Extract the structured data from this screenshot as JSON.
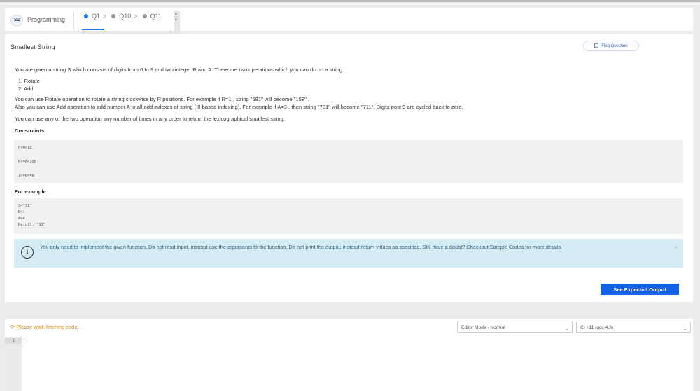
{
  "nav": {
    "section_badge": "S2",
    "section_name": "Programming",
    "questions": [
      {
        "label": "Q1",
        "active": true
      },
      {
        "label": "Q10",
        "active": false
      },
      {
        "label": "Q11",
        "active": false
      }
    ]
  },
  "question": {
    "title": "Smallest String",
    "flag_label": "Flag Question",
    "intro": "You are given a string S which consists of digits from 0 to 9 and two integer R and A. There are two operations which you can do on a string.",
    "operations": [
      "1. Rotate",
      "2. Add"
    ],
    "para_rotate": "You can use Rotate operation to rotate a string clockwise by R positions. For example if R=1 , string \"581\" will become \"158\" .",
    "para_add": "Also you can use Add operation to add number A to all odd indexes of string ( 0 based indexing). For example if A=3 , then string \"781\" will become \"711\". Digits post 9 are cycled back to zero.",
    "para_any": "You can use any of the two operation any number of times in any order to return the lexicographical smallest string.",
    "constraints_heading": "Constraints",
    "constraints": [
      "0<N<10",
      "0<=A<100",
      "1<=R<=N"
    ],
    "example_heading": "For example",
    "example_lines": [
      "S=\"31\"",
      "R=1",
      "A=4",
      "Result: \"11\""
    ]
  },
  "info": {
    "icon": "info-icon",
    "text": "You only need to implement the given function. Do not read input, instead use the arguments to the function. Do not print the output, instead return values as specified. Still have a doubt? Checkout Sample Codes for more details.",
    "close": "×"
  },
  "see_output_label": "See Expected Output",
  "editor": {
    "status": "Please wait, fetching code...",
    "mode_value": "Editor Mode - Normal",
    "language_value": "C++11 (gcc-4.8)",
    "line_number": "1"
  },
  "colors": {
    "accent": "#1560e8",
    "info_bg": "#d5ecf5",
    "warning": "#e08a0c"
  }
}
